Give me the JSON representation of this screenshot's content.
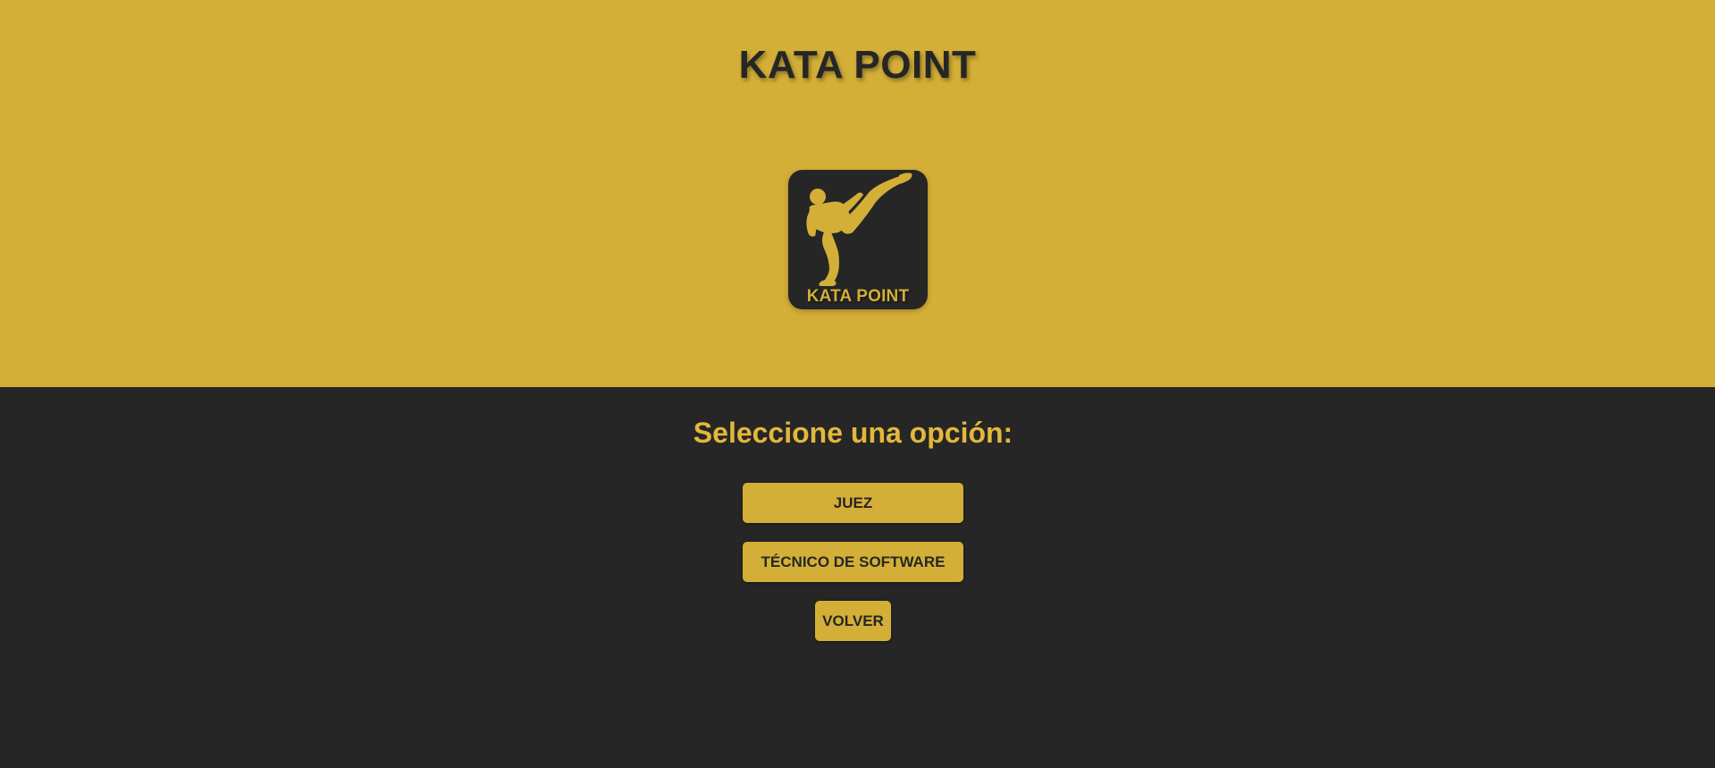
{
  "header": {
    "title": "KATA POINT",
    "background_color": "#d4af37"
  },
  "logo": {
    "icon": "karate-kick-icon",
    "text": "KATA POINT",
    "background_color": "#262626",
    "foreground_color": "#d4af37"
  },
  "main": {
    "prompt": "Seleccione una opción:",
    "background_color": "#262626",
    "prompt_color": "#e3b83a",
    "buttons": [
      {
        "label": "JUEZ"
      },
      {
        "label": "TÉCNICO DE SOFTWARE"
      },
      {
        "label": "VOLVER"
      }
    ]
  }
}
